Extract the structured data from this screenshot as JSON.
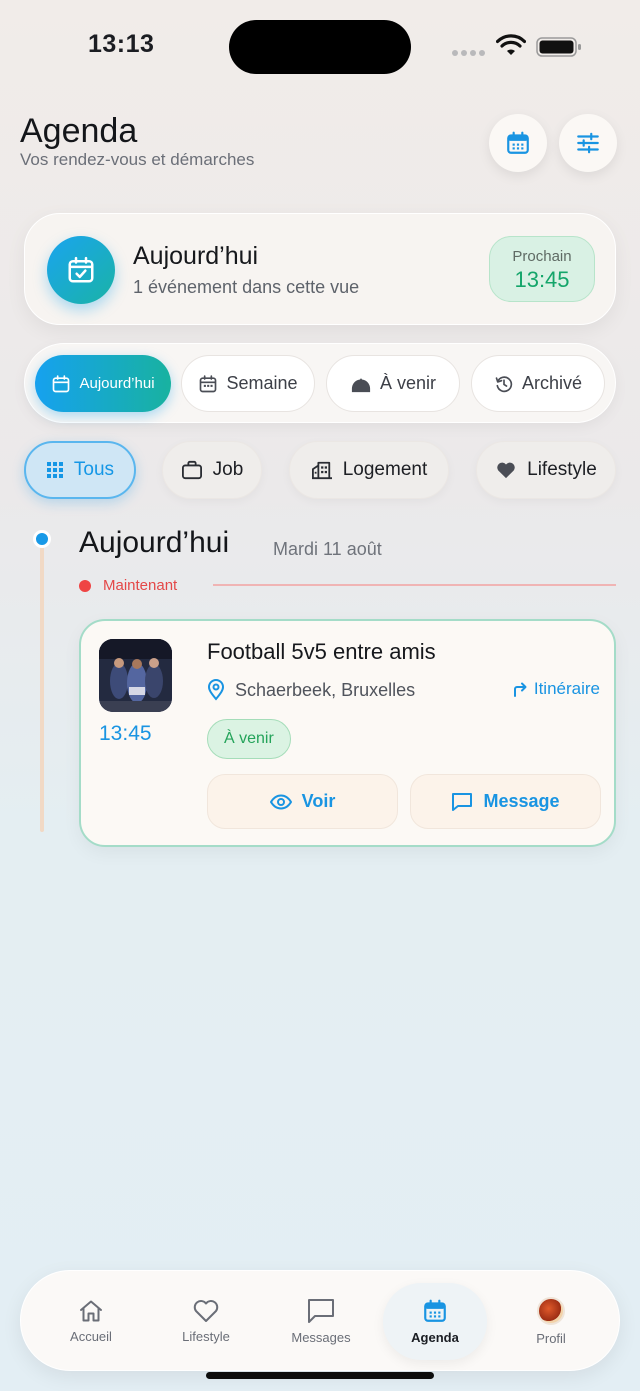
{
  "status_bar": {
    "time": "13:13"
  },
  "header": {
    "title": "Agenda",
    "subtitle": "Vos rendez-vous et démarches",
    "calendar_icon": "calendar-icon",
    "filter_icon": "sliders-icon"
  },
  "today_card": {
    "title": "Aujourd’hui",
    "subtitle": "1 événement dans cette vue",
    "next_label": "Prochain",
    "next_time": "13:45"
  },
  "view_tabs": [
    {
      "label": "Aujourd’hui",
      "icon": "calendar-icon",
      "active": true
    },
    {
      "label": "Semaine",
      "icon": "calendar-week-icon",
      "active": false
    },
    {
      "label": "À venir",
      "icon": "sunrise-icon",
      "active": false
    },
    {
      "label": "Archivé",
      "icon": "history-icon",
      "active": false
    }
  ],
  "categories": [
    {
      "label": "Tous",
      "icon": "grid-icon",
      "active": true
    },
    {
      "label": "Job",
      "icon": "briefcase-icon",
      "active": false
    },
    {
      "label": "Logement",
      "icon": "building-icon",
      "active": false
    },
    {
      "label": "Lifestyle",
      "icon": "heart-icon",
      "active": false
    }
  ],
  "timeline": {
    "day_title": "Aujourd’hui",
    "day_date": "Mardi 11 août",
    "now_label": "Maintenant"
  },
  "event": {
    "time": "13:45",
    "title": "Football 5v5 entre amis",
    "location": "Schaerbeek, Bruxelles",
    "route_label": "Itinéraire",
    "status": "À venir",
    "view_label": "Voir",
    "message_label": "Message"
  },
  "bottom_nav": [
    {
      "label": "Accueil",
      "icon": "home-icon",
      "active": false
    },
    {
      "label": "Lifestyle",
      "icon": "heart-icon",
      "active": false
    },
    {
      "label": "Messages",
      "icon": "message-icon",
      "active": false
    },
    {
      "label": "Agenda",
      "icon": "calendar-icon",
      "active": true
    },
    {
      "label": "Profil",
      "icon": "avatar",
      "active": false
    }
  ],
  "colors": {
    "accent_blue": "#1994e2",
    "accent_teal": "#18b2a0",
    "success_green": "#14a56a",
    "now_red": "#ef4444"
  }
}
